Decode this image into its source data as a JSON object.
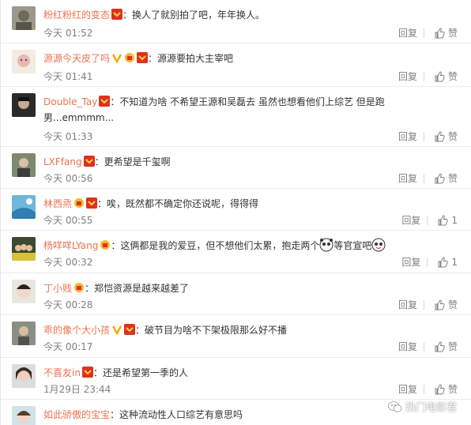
{
  "actions": {
    "reply_label": "回复",
    "like_label": "赞"
  },
  "comments": [
    {
      "name": "粉红粉红的变态",
      "text": "：换人了就别拍了吧，年年换人。",
      "time": "今天 01:52",
      "like": "赞"
    },
    {
      "name": "源源今天皮了吗",
      "text": "：源源要拍大主宰吧",
      "time": "今天 01:41",
      "like": "赞"
    },
    {
      "name": "Double_Tay",
      "text": "：不知道为啥 不希望王源和吴磊去 虽然也想看他们上综艺 但是跑",
      "text2": "男...emmmm...",
      "time": "今天 01:33",
      "like": "赞"
    },
    {
      "name": "LXFfang",
      "text": "：更希望是千玺啊",
      "time": "今天 00:56",
      "like": "赞"
    },
    {
      "name": "林西烝",
      "text": "：唉，既然都不确定你还说呢，得得得",
      "time": "今天 00:55",
      "like": "1"
    },
    {
      "name": "杨咩咩LYang",
      "text": "：这俩都是我的爱豆，但不想他们太累，抱走两个",
      "text2": "等官宣吧",
      "time": "今天 00:32",
      "like": "1"
    },
    {
      "name": "丁小贱",
      "text": "：郑恺资源是越来越差了",
      "time": "今天 00:28",
      "like": "赞"
    },
    {
      "name": "乖的像个大小孩",
      "text": "：破节目为啥不下架极限那么好不播",
      "time": "今天 00:17",
      "like": "赞"
    },
    {
      "name": "不喜友in",
      "text": "：还是希望第一季的人",
      "time": "1月29日 23:44",
      "like": "赞"
    },
    {
      "name": "如此骄傲的宝宝",
      "text": "：这种流动性人口综艺有意思吗",
      "time": "",
      "like": ""
    }
  ],
  "watermark": {
    "label": "热门电影君"
  },
  "colors": {
    "name": "#eb7350",
    "meta": "#808080",
    "text": "#333333"
  }
}
